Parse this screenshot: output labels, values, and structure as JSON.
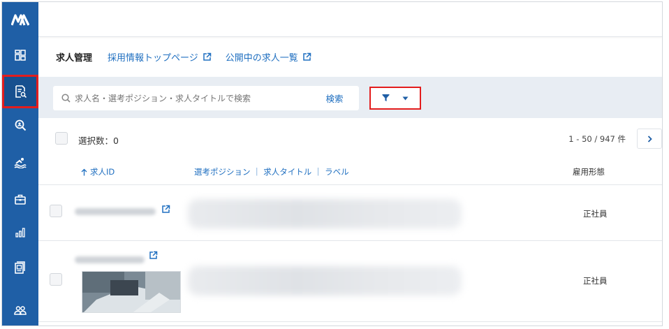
{
  "sidebar": {
    "logo": "M-logo",
    "items": [
      {
        "icon": "dashboard-icon"
      },
      {
        "icon": "job-document-icon",
        "active": true
      },
      {
        "icon": "search-candidates-icon"
      },
      {
        "icon": "swimmer-icon"
      },
      {
        "icon": "briefcase-icon"
      },
      {
        "icon": "analytics-icon"
      },
      {
        "icon": "form-icon"
      },
      {
        "icon": "users-icon"
      }
    ]
  },
  "nav": {
    "current": "求人管理",
    "link1": "採用情報トップページ",
    "link2": "公開中の求人一覧"
  },
  "search": {
    "placeholder": "求人名・選考ポジション・求人タイトルで検索",
    "button": "検索"
  },
  "selection": {
    "label": "選択数：0",
    "count": "1 - 50 / 947 件"
  },
  "columns": {
    "id": "求人ID",
    "position": "選考ポジション ｜ 求人タイトル ｜ ラベル",
    "type": "雇用形態"
  },
  "rows": [
    {
      "employment_type": "正社員"
    },
    {
      "employment_type": "正社員"
    }
  ],
  "colors": {
    "sidebar": "#1f5fa6",
    "link": "#1f6fc0",
    "highlight": "#e31d1d",
    "searchbar_bg": "#e8edf3"
  }
}
